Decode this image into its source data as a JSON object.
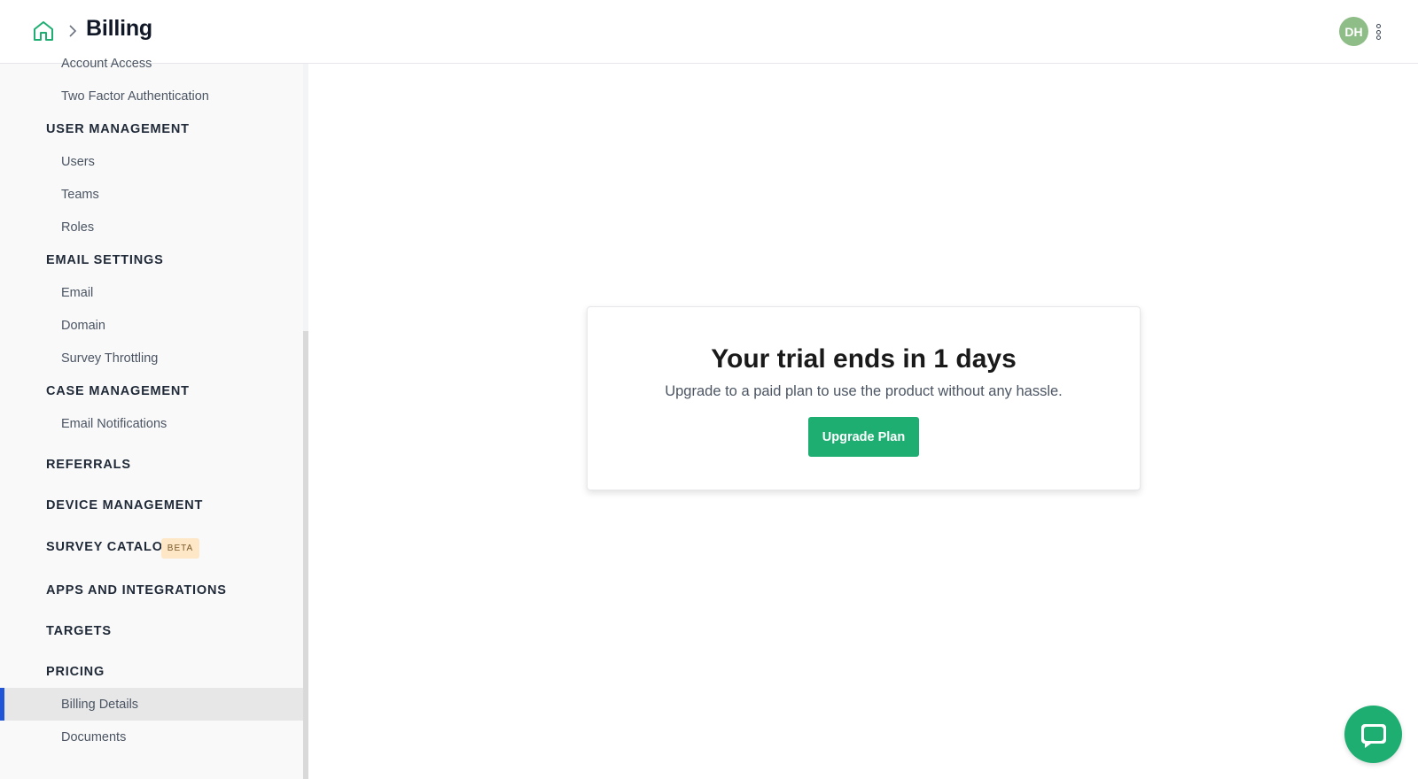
{
  "header": {
    "title": "Billing",
    "home_icon": "home-icon",
    "chevron_icon": "chevron-right-icon",
    "avatar_initials": "DH",
    "menu_icon": "kebab-menu-icon"
  },
  "sidebar": {
    "items": [
      {
        "label": "Account Access",
        "type": "item"
      },
      {
        "label": "Two Factor Authentication",
        "type": "item"
      },
      {
        "label": "USER MANAGEMENT",
        "type": "section"
      },
      {
        "label": "Users",
        "type": "item"
      },
      {
        "label": "Teams",
        "type": "item"
      },
      {
        "label": "Roles",
        "type": "item"
      },
      {
        "label": "EMAIL SETTINGS",
        "type": "section"
      },
      {
        "label": "Email",
        "type": "item"
      },
      {
        "label": "Domain",
        "type": "item"
      },
      {
        "label": "Survey Throttling",
        "type": "item"
      },
      {
        "label": "CASE MANAGEMENT",
        "type": "section"
      },
      {
        "label": "Email Notifications",
        "type": "item"
      },
      {
        "label": "REFERRALS",
        "type": "section"
      },
      {
        "label": "DEVICE MANAGEMENT",
        "type": "section"
      },
      {
        "label": "SURVEY CATALOG",
        "type": "section",
        "badge": "BETA"
      },
      {
        "label": "APPS AND INTEGRATIONS",
        "type": "section"
      },
      {
        "label": "TARGETS",
        "type": "section"
      },
      {
        "label": "PRICING",
        "type": "section"
      },
      {
        "label": "Billing Details",
        "type": "item",
        "active": true
      },
      {
        "label": "Documents",
        "type": "item"
      }
    ]
  },
  "card": {
    "title": "Your trial ends in 1 days",
    "subtitle": "Upgrade to a paid plan to use the product without any hassle.",
    "button_label": "Upgrade Plan"
  },
  "chat_widget": {
    "icon": "chat-bubble-icon"
  },
  "colors": {
    "accent_green": "#1eae72",
    "active_indicator": "#1f55d6",
    "avatar_bg": "#8ebd87",
    "beta_badge_bg": "#fde7c6"
  }
}
